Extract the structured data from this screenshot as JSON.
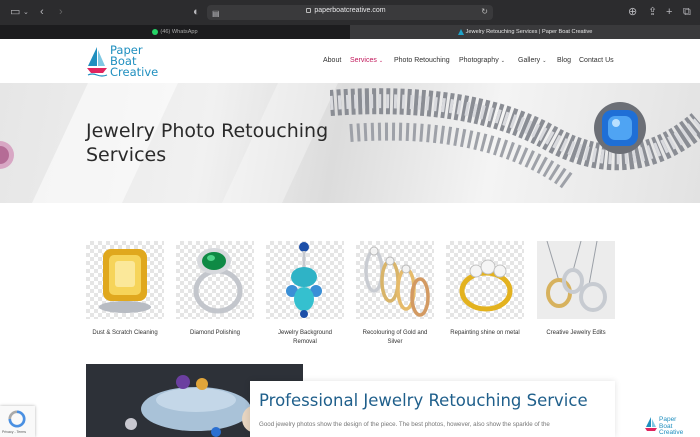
{
  "browser": {
    "url": "paperboatcreative.com",
    "tabs": [
      {
        "label": "(46) WhatsApp",
        "active": false
      },
      {
        "label": "Jewelry Retouching Services | Paper Boat Creative",
        "active": true
      }
    ]
  },
  "header": {
    "logo": {
      "line1": "Paper",
      "line2": "Boat",
      "line3": "Creative"
    },
    "nav": [
      {
        "label": "About",
        "has_caret": false,
        "active": false
      },
      {
        "label": "Services",
        "has_caret": true,
        "active": true
      },
      {
        "label": "Photo Retouching",
        "has_caret": false,
        "active": false
      },
      {
        "label": "Photography",
        "has_caret": true,
        "active": false
      },
      {
        "label": "Gallery",
        "has_caret": true,
        "active": false
      },
      {
        "label": "Blog",
        "has_caret": false,
        "active": false
      },
      {
        "label": "Contact Us",
        "has_caret": false,
        "active": false
      }
    ],
    "caret_glyph": "⌄"
  },
  "hero": {
    "title_line1": "Jewelry Photo Retouching",
    "title_line2": "Services"
  },
  "services": [
    {
      "caption": "Dust & Scratch Cleaning"
    },
    {
      "caption": "Diamond Polishing"
    },
    {
      "caption": "Jewelry Background Removal"
    },
    {
      "caption": "Recolouring of Gold and Silver"
    },
    {
      "caption": "Repainting shine on metal"
    },
    {
      "caption": "Creative Jewelry Edits"
    }
  ],
  "section": {
    "heading": "Professional Jewelry Retouching Service",
    "text": "Good jewelry photos show the design of the piece. The best photos, however, also show the sparkle of the"
  },
  "recaptcha": {
    "text": "Privacy - Terms"
  },
  "float_logo": {
    "line1": "Paper",
    "line2": "Boat",
    "line3": "Creative"
  },
  "colors": {
    "accent": "#c2185b",
    "brand": "#1f8fbf",
    "heading": "#1f5f8b"
  }
}
